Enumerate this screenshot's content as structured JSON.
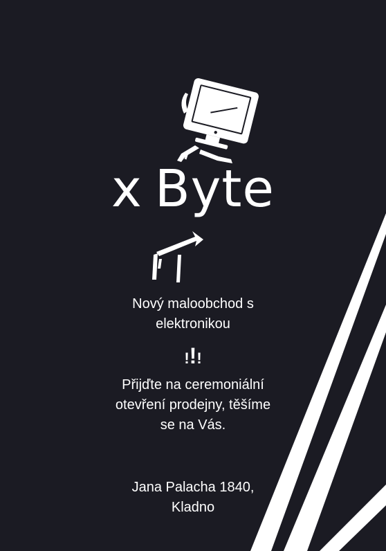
{
  "brand": {
    "prefix": "x",
    "name": "Byte"
  },
  "tagline": {
    "line1": "Nový maloobchod s",
    "line2": "elektronikou"
  },
  "exclaim": {
    "left": "!",
    "center": "!",
    "right": "!"
  },
  "invite": {
    "line1": "Přijďte na ceremoniální",
    "line2": "otevření prodejny, těšíme",
    "line3": "se na Vás."
  },
  "address": {
    "line1": "Jana Palacha 1840,",
    "line2": "Kladno"
  },
  "colors": {
    "background": "#1b1b23",
    "foreground": "#ffffff"
  },
  "icons": [
    "computer-monitor-robot-icon"
  ]
}
